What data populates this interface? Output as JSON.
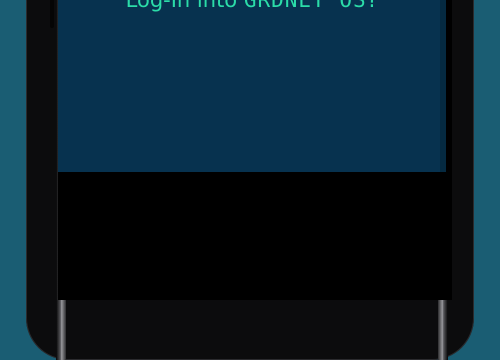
{
  "heading": {
    "prefix": "Log-In into",
    "brand": "GRDNET OS",
    "suffix": "?"
  },
  "colors": {
    "background": "#1a5d73",
    "panel": "#07324f",
    "accent": "#2bdca8",
    "screen": "#000000"
  }
}
